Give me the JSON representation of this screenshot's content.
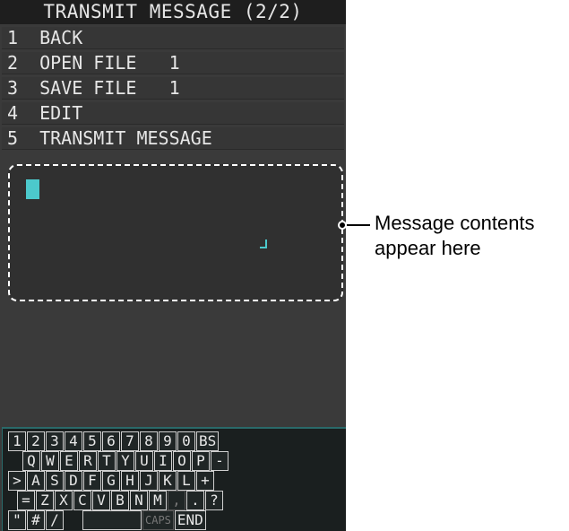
{
  "title": "TRANSMIT MESSAGE (2/2)",
  "menu": [
    {
      "num": "1",
      "label": "BACK"
    },
    {
      "num": "2",
      "label": "OPEN FILE   1"
    },
    {
      "num": "3",
      "label": "SAVE FILE   1"
    },
    {
      "num": "4",
      "label": "EDIT"
    },
    {
      "num": "5",
      "label": "TRANSMIT MESSAGE"
    }
  ],
  "callout": {
    "line1": "Message contents",
    "line2": "appear here"
  },
  "keyboard": {
    "row1": [
      "1",
      "2",
      "3",
      "4",
      "5",
      "6",
      "7",
      "8",
      "9",
      "0",
      "BS"
    ],
    "row2": [
      "Q",
      "W",
      "E",
      "R",
      "T",
      "Y",
      "U",
      "I",
      "O",
      "P",
      "-"
    ],
    "row3": [
      ">",
      "A",
      "S",
      "D",
      "F",
      "G",
      "H",
      "J",
      "K",
      "L",
      "+"
    ],
    "row4": [
      "=",
      "Z",
      "X",
      "C",
      "V",
      "B",
      "N",
      "M",
      ",",
      ".",
      "?"
    ],
    "row5": [
      "\"",
      "#",
      "/",
      "",
      "CAPS",
      "END"
    ]
  },
  "colors": {
    "screen_bg": "#3a3a3a",
    "cursor": "#4cc9cc",
    "keyboard_bg": "#1a1f1f"
  }
}
